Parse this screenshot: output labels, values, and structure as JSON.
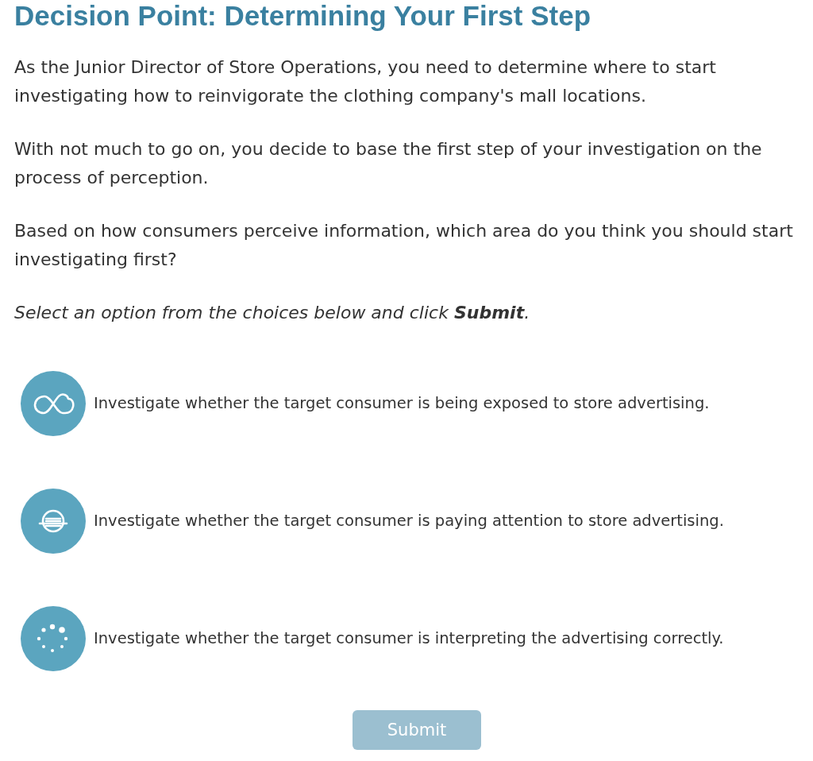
{
  "title": "Decision Point: Determining Your First Step",
  "paragraphs": [
    {
      "kind": "body",
      "text": "As the Junior Director of Store Operations, you need to determine where to start investigating how to reinvigorate the clothing company's mall locations."
    },
    {
      "kind": "body",
      "text": "With not much to go on, you decide to base the first step of your investigation on the process of perception."
    },
    {
      "kind": "body",
      "text": "Based on how consumers perceive information, which area do you think you should start investigating first?"
    },
    {
      "kind": "instruction",
      "text": "Select an option from the choices below and click **Submit**."
    }
  ],
  "options": [
    {
      "label": "Investigate whether the target consumer is being exposed to store advertising.",
      "selected": false
    },
    {
      "label": "Investigate whether the target consumer is paying attention to store advertising.",
      "selected": false
    },
    {
      "label": "Investigate whether the target consumer is interpreting the advertising correctly.",
      "selected": false
    }
  ],
  "submit": {
    "label": "Submit",
    "disabled": true
  }
}
